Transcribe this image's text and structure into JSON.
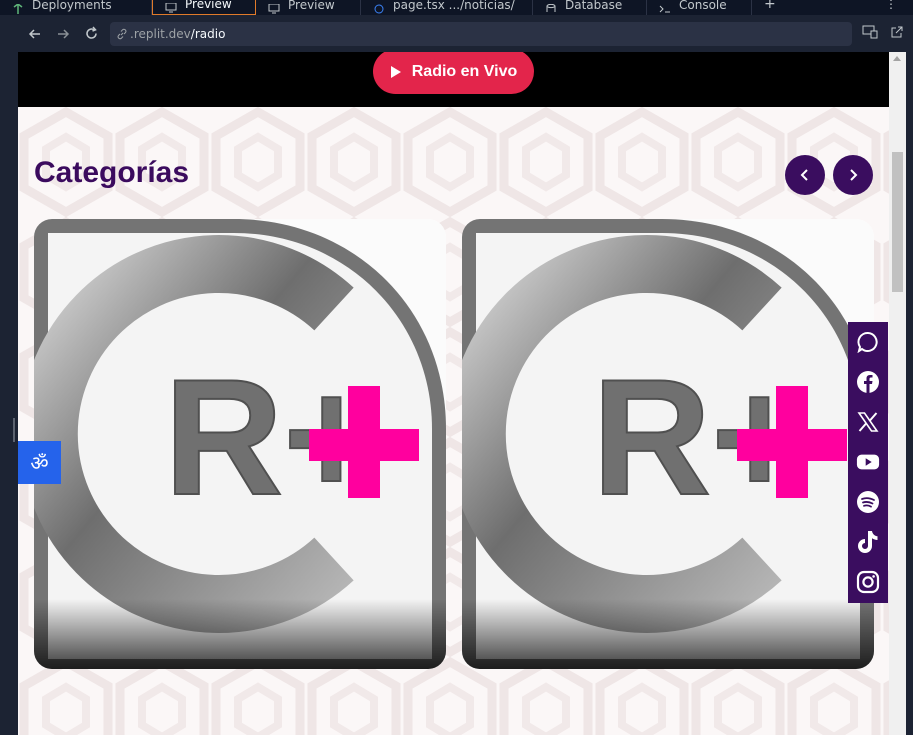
{
  "tabs": [
    {
      "label": "Deployments",
      "icon": "deploy-icon",
      "active": false
    },
    {
      "label": "Preview",
      "icon": "monitor-icon",
      "active": true
    },
    {
      "label": "Preview",
      "icon": "monitor-icon",
      "active": false
    },
    {
      "label": "page.tsx .../noticias/",
      "icon": "file-icon",
      "active": false
    },
    {
      "label": "Database",
      "icon": "database-icon",
      "active": false
    },
    {
      "label": "Console",
      "icon": "terminal-icon",
      "active": false
    }
  ],
  "tab_add": "+",
  "tab_more": "⋮",
  "url": {
    "host": ".replit.dev",
    "path": "/radio"
  },
  "page": {
    "live_button": "Radio en Vivo",
    "categories_title": "Categorías",
    "card_logo_text": "R+"
  },
  "social": [
    "whatsapp-icon",
    "facebook-icon",
    "x-icon",
    "youtube-icon",
    "spotify-icon",
    "tiktok-icon",
    "instagram-icon"
  ],
  "colors": {
    "accent_purple": "#3a0d5f",
    "live_red": "#e3254b",
    "plus_magenta": "#ff009e",
    "access_blue": "#2563eb",
    "active_tab_border": "#e07a2a"
  }
}
